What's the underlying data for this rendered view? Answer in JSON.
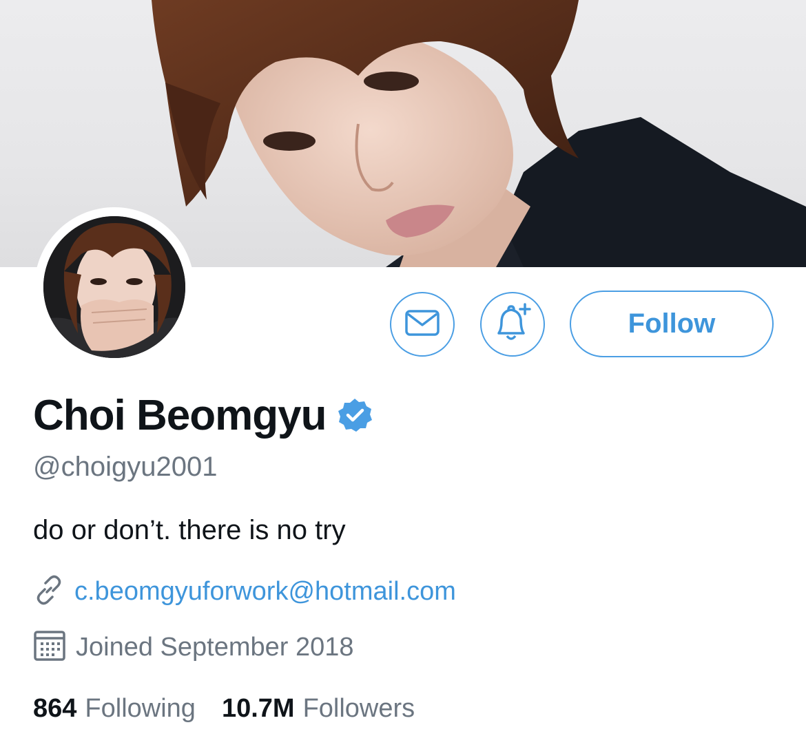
{
  "profile": {
    "display_name": "Choi Beomgyu",
    "handle": "@choigyu2001",
    "bio": "do or don’t. there is no try",
    "link": "c.beomgyuforwork@hotmail.com",
    "joined": "Joined September 2018",
    "following_count": "864",
    "following_label": "Following",
    "followers_count": "10.7M",
    "followers_label": "Followers"
  },
  "actions": {
    "follow_label": "Follow",
    "message_icon": "envelope-icon",
    "notify_icon": "bell-plus-icon"
  },
  "icons": {
    "verified": "verified-badge-icon",
    "link": "link-icon",
    "calendar": "calendar-icon"
  },
  "colors": {
    "accent": "#3e95db",
    "verified": "#4a9ee4",
    "text_primary": "#0f1419",
    "text_secondary": "#6b7580"
  }
}
